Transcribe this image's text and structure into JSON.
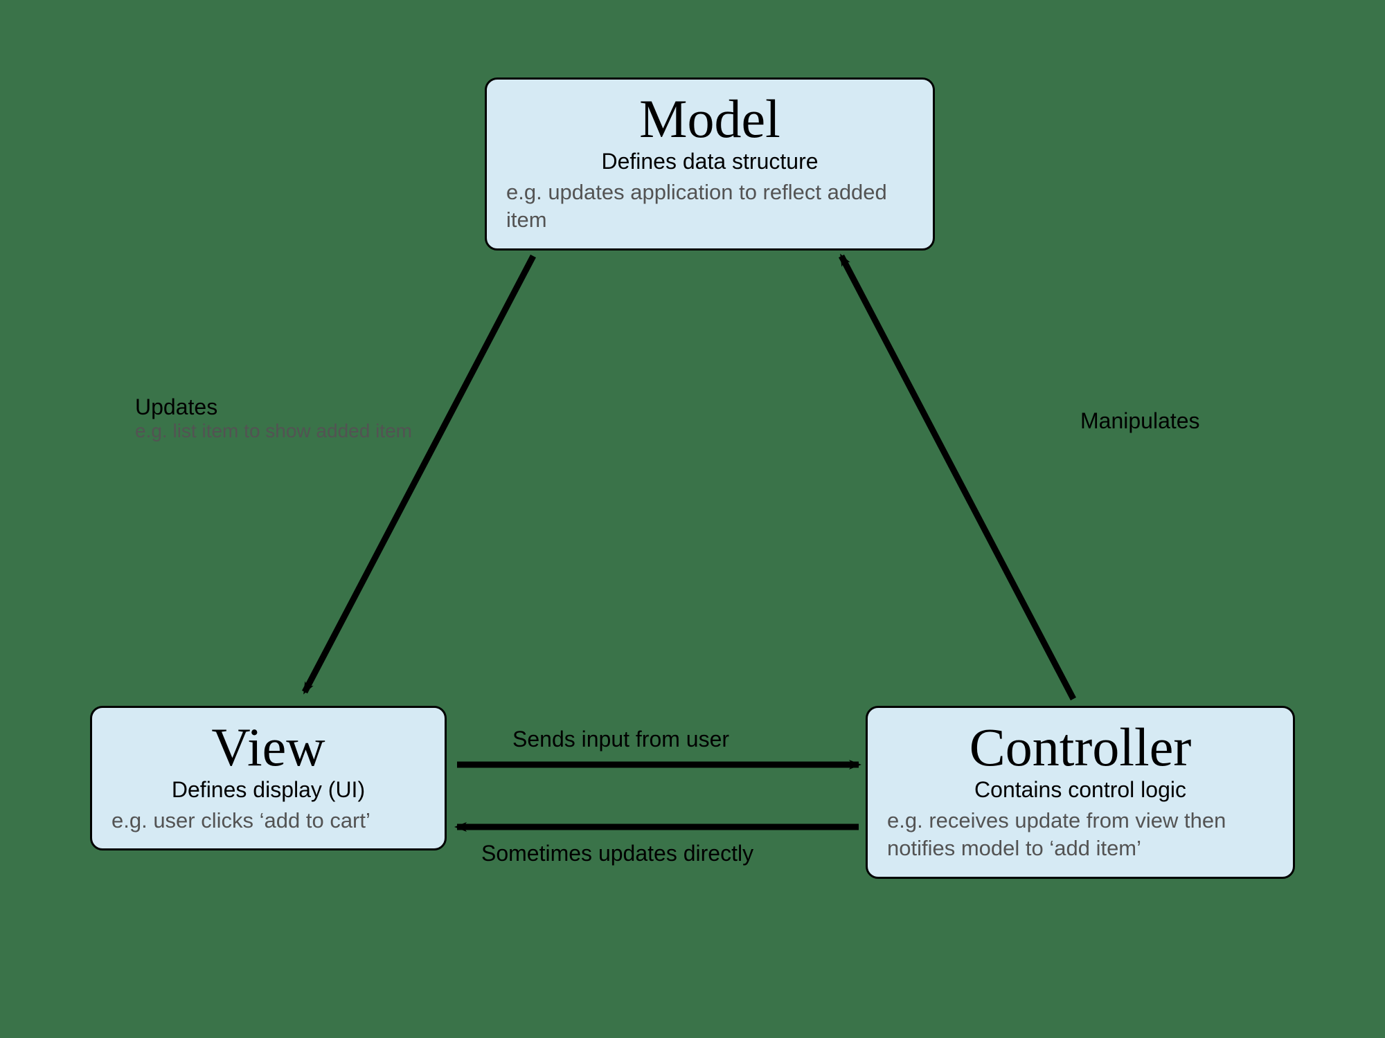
{
  "nodes": {
    "model": {
      "title": "Model",
      "subtitle": "Defines data structure",
      "example": "e.g. updates application to reflect added item"
    },
    "view": {
      "title": "View",
      "subtitle": "Defines display (UI)",
      "example": "e.g. user clicks ‘add to cart’"
    },
    "controller": {
      "title": "Controller",
      "subtitle": "Contains control logic",
      "example": "e.g. receives update from view then notifies model to ‘add item’"
    }
  },
  "edges": {
    "model_to_view": {
      "label": "Updates",
      "sublabel": "e.g. list item to show added item"
    },
    "controller_to_model": {
      "label": "Manipulates"
    },
    "view_to_controller": {
      "label": "Sends input from user"
    },
    "controller_to_view": {
      "label": "Sometimes updates directly"
    }
  }
}
